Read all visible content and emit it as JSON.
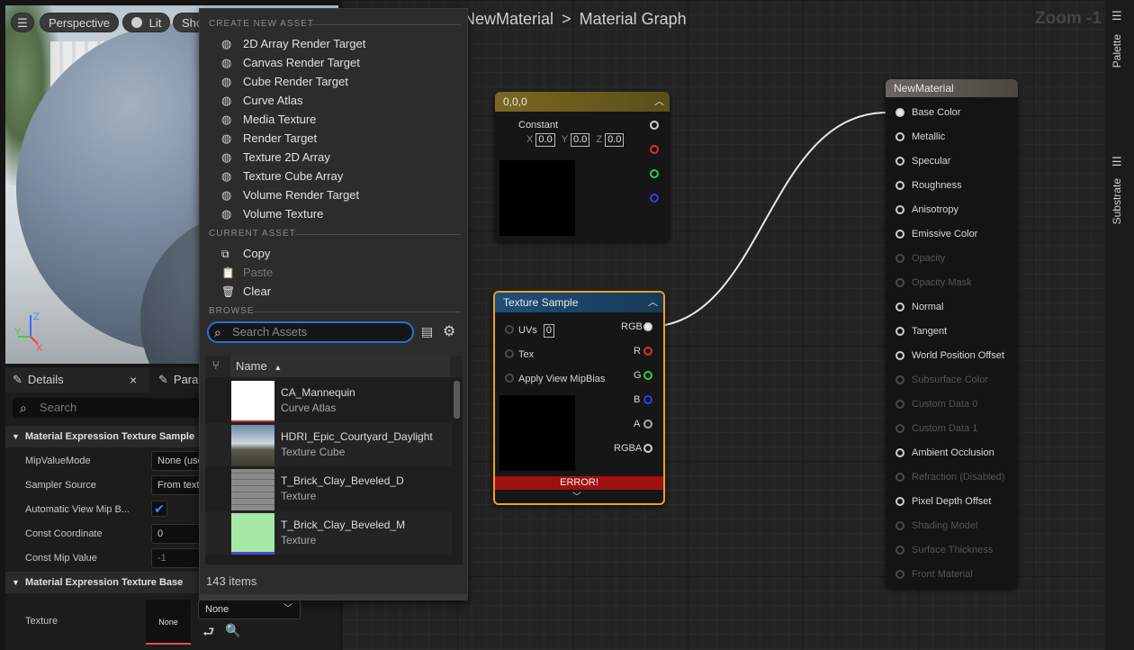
{
  "viewport": {
    "menu_icon": "hamburger-icon",
    "perspective": "Perspective",
    "lit": "Lit",
    "show": "Show",
    "axis": {
      "z": "Z",
      "y": "Y",
      "x": "X"
    }
  },
  "details": {
    "tab_details": "Details",
    "tab_params": "Parameters",
    "search_placeholder": "Search",
    "cat_sample": "Material Expression Texture Sample",
    "cat_base": "Material Expression Texture Base",
    "props": [
      {
        "label": "MipValueMode",
        "value": "None (use"
      },
      {
        "label": "Sampler Source",
        "value": "From text"
      },
      {
        "label": "Automatic View Mip B...",
        "value": ""
      },
      {
        "label": "Const Coordinate",
        "value": "0"
      },
      {
        "label": "Const Mip Value",
        "value": "-1"
      }
    ],
    "texture_label": "Texture",
    "texture_thumb": "None",
    "texture_combo": "None"
  },
  "graph": {
    "breadcrumb_asset": "NewMaterial",
    "breadcrumb_sep": ">",
    "breadcrumb_view": "Material Graph",
    "zoom": "Zoom -1",
    "const_node": {
      "title": "0,0,0",
      "label": "Constant",
      "x_lbl": "X",
      "x_val": "0.0",
      "y_lbl": "Y",
      "y_val": "0.0",
      "z_lbl": "Z",
      "z_val": "0.0"
    },
    "tex_node": {
      "title": "Texture Sample",
      "inputs": [
        {
          "label": "UVs",
          "value": "0"
        },
        {
          "label": "Tex",
          "value": ""
        },
        {
          "label": "Apply View MipBias",
          "value": ""
        }
      ],
      "outputs": [
        "RGB",
        "R",
        "G",
        "B",
        "A",
        "RGBA"
      ],
      "error": "ERROR!"
    },
    "mat_node": {
      "title": "NewMaterial",
      "pins": [
        {
          "label": "Base Color",
          "enabled": true
        },
        {
          "label": "Metallic",
          "enabled": true
        },
        {
          "label": "Specular",
          "enabled": true
        },
        {
          "label": "Roughness",
          "enabled": true
        },
        {
          "label": "Anisotropy",
          "enabled": true
        },
        {
          "label": "Emissive Color",
          "enabled": true
        },
        {
          "label": "Opacity",
          "enabled": false
        },
        {
          "label": "Opacity Mask",
          "enabled": false
        },
        {
          "label": "Normal",
          "enabled": true
        },
        {
          "label": "Tangent",
          "enabled": true
        },
        {
          "label": "World Position Offset",
          "enabled": true
        },
        {
          "label": "Subsurface Color",
          "enabled": false
        },
        {
          "label": "Custom Data 0",
          "enabled": false
        },
        {
          "label": "Custom Data 1",
          "enabled": false
        },
        {
          "label": "Ambient Occlusion",
          "enabled": true
        },
        {
          "label": "Refraction (Disabled)",
          "enabled": false
        },
        {
          "label": "Pixel Depth Offset",
          "enabled": true
        },
        {
          "label": "Shading Model",
          "enabled": false
        },
        {
          "label": "Surface Thickness",
          "enabled": false
        },
        {
          "label": "Front Material",
          "enabled": false
        }
      ]
    }
  },
  "side": {
    "palette": "Palette",
    "substrate": "Substrate"
  },
  "menu": {
    "create_header": "CREATE NEW ASSET",
    "create_items": [
      "2D Array Render Target",
      "Canvas Render Target",
      "Cube Render Target",
      "Curve Atlas",
      "Media Texture",
      "Render Target",
      "Texture 2D Array",
      "Texture Cube Array",
      "Volume Render Target",
      "Volume Texture"
    ],
    "current_header": "CURRENT ASSET",
    "copy": "Copy",
    "paste": "Paste",
    "clear": "Clear",
    "browse_header": "BROWSE",
    "search_placeholder": "Search Assets",
    "col_name": "Name",
    "assets": [
      {
        "name": "CA_Mannequin",
        "type": "Curve Atlas"
      },
      {
        "name": "HDRI_Epic_Courtyard_Daylight",
        "type": "Texture Cube"
      },
      {
        "name": "T_Brick_Clay_Beveled_D",
        "type": "Texture"
      },
      {
        "name": "T_Brick_Clay_Beveled_M",
        "type": "Texture"
      }
    ],
    "item_count": "143 items"
  }
}
